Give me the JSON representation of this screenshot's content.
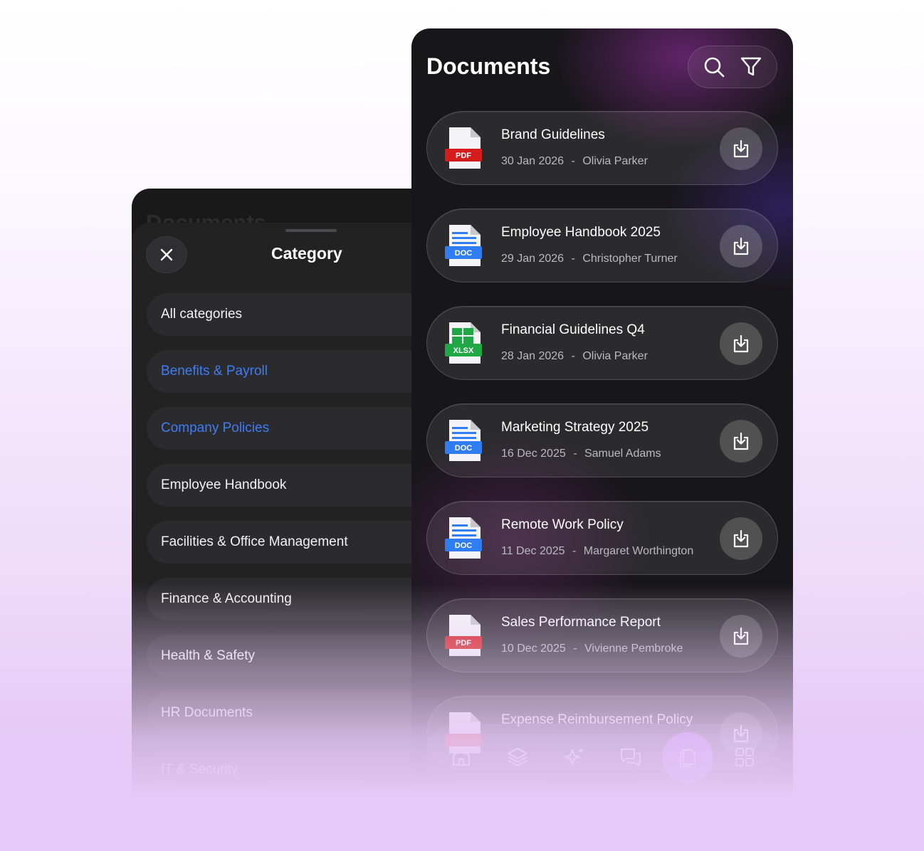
{
  "category_sheet": {
    "behind_title": "Documents",
    "title": "Category",
    "items": [
      {
        "label": "All categories",
        "active": false
      },
      {
        "label": "Benefits & Payroll",
        "active": true
      },
      {
        "label": "Company Policies",
        "active": true
      },
      {
        "label": "Employee Handbook",
        "active": false
      },
      {
        "label": "Facilities & Office Management",
        "active": false
      },
      {
        "label": "Finance & Accounting",
        "active": false
      },
      {
        "label": "Health & Safety",
        "active": false
      },
      {
        "label": "HR Documents",
        "active": false
      },
      {
        "label": "IT & Security",
        "active": false
      }
    ]
  },
  "documents": {
    "title": "Documents",
    "items": [
      {
        "name": "Brand Guidelines",
        "date": "30 Jan 2026",
        "author": "Olivia Parker",
        "type": "PDF"
      },
      {
        "name": "Employee Handbook 2025",
        "date": "29 Jan 2026",
        "author": "Christopher Turner",
        "type": "DOC"
      },
      {
        "name": "Financial Guidelines Q4",
        "date": "28 Jan 2026",
        "author": "Olivia Parker",
        "type": "XLSX"
      },
      {
        "name": "Marketing Strategy 2025",
        "date": "16 Dec 2025",
        "author": "Samuel Adams",
        "type": "DOC"
      },
      {
        "name": "Remote Work Policy",
        "date": "11 Dec 2025",
        "author": "Margaret Worthington",
        "type": "DOC"
      },
      {
        "name": "Sales Performance Report",
        "date": "10 Dec 2025",
        "author": "Vivienne Pembroke",
        "type": "PDF"
      },
      {
        "name": "Expense Reimbursement Policy",
        "date": "",
        "author": "",
        "type": "PDF"
      }
    ],
    "separator": "-"
  },
  "nav": {
    "items": [
      "home-icon",
      "layers-icon",
      "sparkles-icon",
      "chat-icon",
      "documents-icon",
      "grid-icon"
    ],
    "active": "documents-icon"
  },
  "colors": {
    "accent_blue": "#3f7cf5",
    "pdf_red": "#d51c1c",
    "doc_blue": "#2f7df0",
    "xlsx_green": "#1fa845",
    "nav_active": "#b055f0"
  }
}
